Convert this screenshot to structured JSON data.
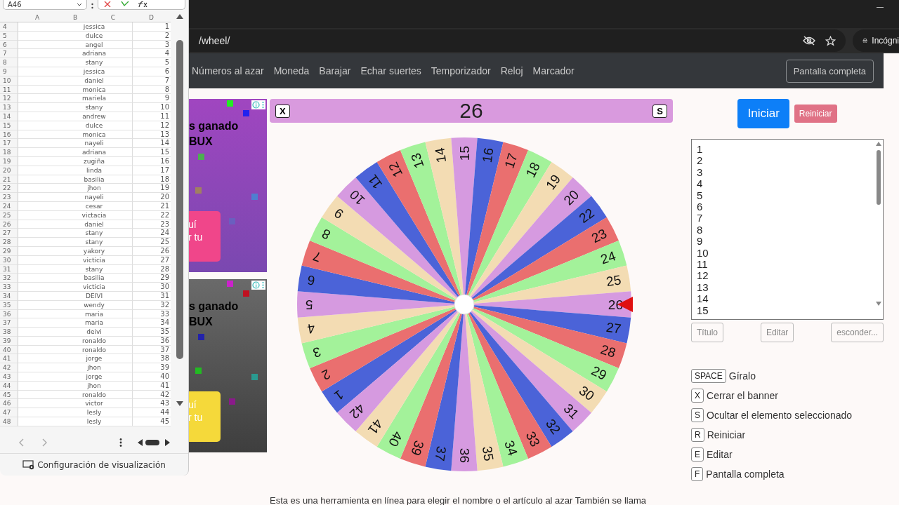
{
  "browser": {
    "address": "/wheel/",
    "profile": "Incógni"
  },
  "nav": {
    "links": [
      "Números al azar",
      "Moneda",
      "Barajar",
      "Echar suertes",
      "Temporizador",
      "Reloj",
      "Marcador"
    ],
    "fullscreen_button": "Pantalla completa"
  },
  "ads": [
    {
      "headline": "s ganado",
      "subline": "BUX",
      "cta_lines": [
        "uí",
        "r tu"
      ],
      "kind": "purple"
    },
    {
      "headline": "s ganado",
      "subline": "BUX",
      "cta_lines": [
        "uí",
        "r tu"
      ],
      "kind": "dark"
    }
  ],
  "wheel": {
    "close_key": "X",
    "result": "26",
    "hide_key": "S",
    "segments": [
      "1",
      "2",
      "3",
      "4",
      "5",
      "6",
      "7",
      "8",
      "9",
      "10",
      "11",
      "12",
      "13",
      "14",
      "15",
      "16",
      "17",
      "18",
      "19",
      "20",
      "22",
      "23",
      "24",
      "25",
      "26",
      "27",
      "28",
      "29",
      "30",
      "31",
      "32",
      "33",
      "34",
      "35",
      "36",
      "37",
      "39",
      "40",
      "41",
      "42"
    ]
  },
  "controls": {
    "start_button": "Iniciar",
    "reset_button": "Reiniciar",
    "entries": [
      "1",
      "2",
      "3",
      "4",
      "5",
      "6",
      "7",
      "8",
      "9",
      "10",
      "11",
      "12",
      "13",
      "14",
      "15"
    ],
    "buttons": [
      "Título",
      "Editar",
      "esconder..."
    ]
  },
  "shortcuts": [
    {
      "key": "SPACE",
      "action": "Gíralo"
    },
    {
      "key": "X",
      "action": "Cerrar el banner"
    },
    {
      "key": "S",
      "action": "Ocultar el elemento seleccionado"
    },
    {
      "key": "R",
      "action": "Reiniciar"
    },
    {
      "key": "E",
      "action": "Editar"
    },
    {
      "key": "F",
      "action": "Pantalla completa"
    }
  ],
  "description": "Esta es una herramienta en línea para elegir el nombre o el artículo al azar También se llama",
  "spreadsheet": {
    "name_box": "A46",
    "columns": [
      "A",
      "B",
      "C",
      "D"
    ],
    "footer": "Configuración de visualización",
    "rows": [
      {
        "row": "4",
        "name": "jessica",
        "number": "1"
      },
      {
        "row": "5",
        "name": "dulce",
        "number": "2"
      },
      {
        "row": "6",
        "name": "angel",
        "number": "3"
      },
      {
        "row": "7",
        "name": "adriana",
        "number": "4"
      },
      {
        "row": "8",
        "name": "stany",
        "number": "5"
      },
      {
        "row": "9",
        "name": "jessica",
        "number": "6"
      },
      {
        "row": "10",
        "name": "daniel",
        "number": "7"
      },
      {
        "row": "11",
        "name": "monica",
        "number": "8"
      },
      {
        "row": "12",
        "name": "mariela",
        "number": "9"
      },
      {
        "row": "13",
        "name": "stany",
        "number": "10"
      },
      {
        "row": "14",
        "name": "andrew",
        "number": "11"
      },
      {
        "row": "15",
        "name": "dulce",
        "number": "12"
      },
      {
        "row": "16",
        "name": "monica",
        "number": "13"
      },
      {
        "row": "17",
        "name": "nayeli",
        "number": "14"
      },
      {
        "row": "18",
        "name": "adriana",
        "number": "15"
      },
      {
        "row": "19",
        "name": "zugiña",
        "number": "16"
      },
      {
        "row": "20",
        "name": "linda",
        "number": "17"
      },
      {
        "row": "21",
        "name": "basilia",
        "number": "18"
      },
      {
        "row": "22",
        "name": "jhon",
        "number": "19"
      },
      {
        "row": "23",
        "name": "nayeli",
        "number": "20"
      },
      {
        "row": "24",
        "name": "cesar",
        "number": "21"
      },
      {
        "row": "25",
        "name": "victacia",
        "number": "22"
      },
      {
        "row": "26",
        "name": "daniel",
        "number": "23"
      },
      {
        "row": "27",
        "name": "stany",
        "number": "24"
      },
      {
        "row": "28",
        "name": "stany",
        "number": "25"
      },
      {
        "row": "29",
        "name": "yakory",
        "number": "26"
      },
      {
        "row": "30",
        "name": "victicia",
        "number": "27"
      },
      {
        "row": "31",
        "name": "stany",
        "number": "28"
      },
      {
        "row": "32",
        "name": "basilia",
        "number": "29"
      },
      {
        "row": "33",
        "name": "victicia",
        "number": "30"
      },
      {
        "row": "34",
        "name": "DEIVI",
        "number": "31"
      },
      {
        "row": "35",
        "name": "wendy",
        "number": "32"
      },
      {
        "row": "36",
        "name": "maria",
        "number": "33"
      },
      {
        "row": "37",
        "name": "maria",
        "number": "34"
      },
      {
        "row": "38",
        "name": "deivi",
        "number": "35"
      },
      {
        "row": "39",
        "name": "ronaldo",
        "number": "36"
      },
      {
        "row": "40",
        "name": "ronaldo",
        "number": "37"
      },
      {
        "row": "41",
        "name": "jorge",
        "number": "38"
      },
      {
        "row": "42",
        "name": "jhon",
        "number": "39"
      },
      {
        "row": "43",
        "name": "jorge",
        "number": "40"
      },
      {
        "row": "44",
        "name": "jhon",
        "number": "41"
      },
      {
        "row": "45",
        "name": "ronaldo",
        "number": "42"
      },
      {
        "row": "46",
        "name": "victor",
        "number": "43"
      },
      {
        "row": "47",
        "name": "lesly",
        "number": "44"
      },
      {
        "row": "48",
        "name": "lesly",
        "number": "45"
      }
    ]
  }
}
